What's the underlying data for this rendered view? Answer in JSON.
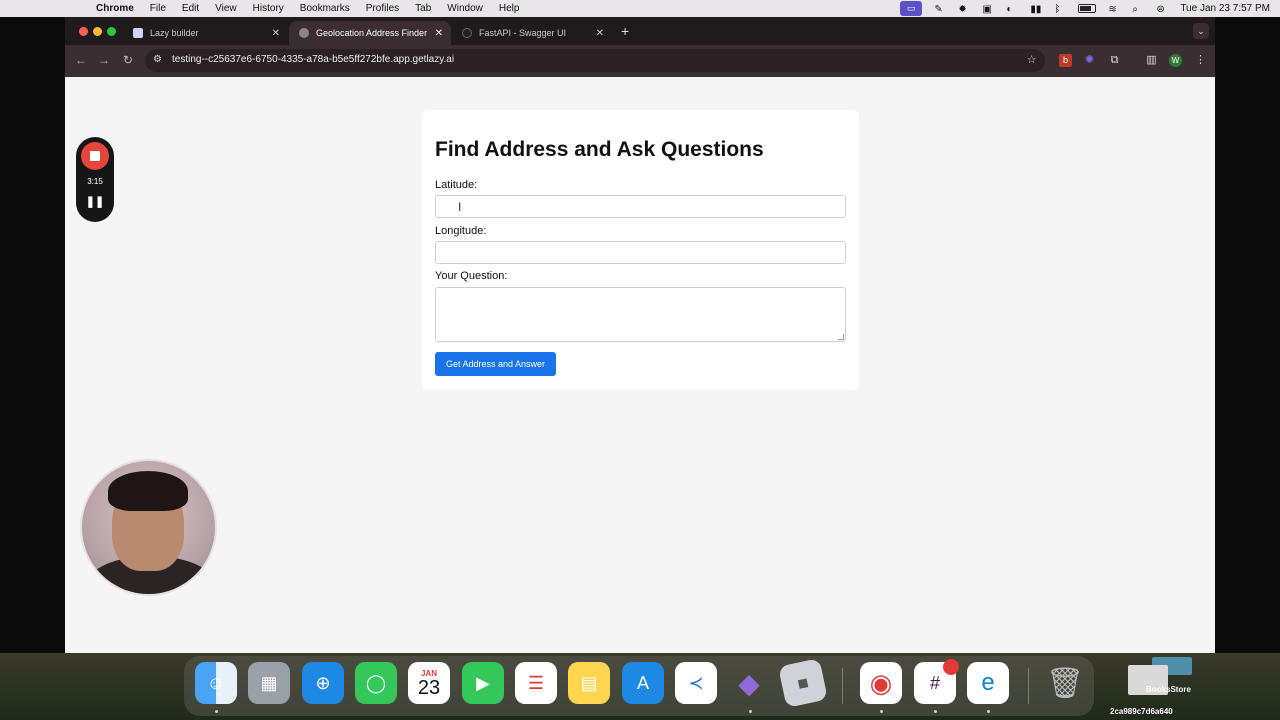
{
  "menubar": {
    "app_name": "Chrome",
    "items": [
      "File",
      "Edit",
      "View",
      "History",
      "Bookmarks",
      "Profiles",
      "Tab",
      "Window",
      "Help"
    ],
    "datetime": "Tue Jan 23  7:57 PM"
  },
  "browser": {
    "tabs": [
      {
        "title": "Lazy builder",
        "active": false
      },
      {
        "title": "Geolocation Address Finder",
        "active": true
      },
      {
        "title": "FastAPI - Swagger UI",
        "active": false
      }
    ],
    "url": "testing--c25637e6-6750-4335-a78a-b5e5ff272bfe.app.getlazy.ai",
    "extension_w_label": "W",
    "extension_b_label": "b"
  },
  "page": {
    "title": "Find Address and Ask Questions",
    "latitude_label": "Latitude:",
    "latitude_value": "",
    "longitude_label": "Longitude:",
    "longitude_value": "",
    "question_label": "Your Question:",
    "question_value": "",
    "submit_label": "Get Address and Answer"
  },
  "recorder": {
    "elapsed": "3:15"
  },
  "dock": {
    "calendar_month": "JAN",
    "calendar_day": "23",
    "apps": [
      "Finder",
      "Launchpad",
      "Safari",
      "Messages",
      "Calendar",
      "FaceTime",
      "Reminders",
      "Notes",
      "App Store",
      "VS Code",
      "Obsidian",
      "Roblox Studio",
      "Chrome",
      "Slack",
      "Edge",
      "Trash"
    ]
  },
  "desktop": {
    "folder_label": "BooksStore",
    "file_label": "2ca989c7d6a640"
  },
  "colors": {
    "accent": "#1a73e8",
    "tab_strip": "#1f1a1c",
    "toolbar": "#3a2e32",
    "record_red": "#e8453c"
  }
}
